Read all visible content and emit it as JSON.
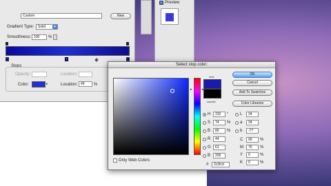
{
  "gradient_editor": {
    "name_value": "Custom",
    "new_button": "New",
    "gradient_type_label": "Gradient Type:",
    "gradient_type_value": "Solid",
    "smoothness_label": "Smoothness:",
    "smoothness_value": "100",
    "smoothness_unit": "%",
    "stops_label": "Stops",
    "opacity_label": "Opacity:",
    "location_label": "Location:",
    "color_label": "Color:",
    "color_location_value": "49",
    "percent": "%",
    "stop_color": "#1f2fd1"
  },
  "styles_panel": {
    "preview_label": "Preview",
    "swatch_color": "#3a3ad8"
  },
  "color_picker": {
    "title": "Select stop color:",
    "new_label": "new",
    "current_label": "current",
    "ok": "OK",
    "cancel": "Cancel",
    "add_swatches": "Add To Swatches",
    "color_libraries": "Color Libraries",
    "only_web_colors": "Only Web Colors",
    "new_color": "#1a1ab0",
    "current_color": "#000000",
    "hsb": [
      {
        "key": "H",
        "value": "232",
        "unit": "°",
        "selected": true
      },
      {
        "key": "S",
        "value": "74",
        "unit": "%",
        "selected": false
      },
      {
        "key": "B",
        "value": "80",
        "unit": "%",
        "selected": false
      }
    ],
    "rgb": [
      {
        "key": "R",
        "value": "44",
        "selected": false
      },
      {
        "key": "G",
        "value": "61",
        "selected": false
      },
      {
        "key": "B",
        "value": "205",
        "selected": false
      }
    ],
    "lab": [
      {
        "key": "L",
        "value": "34",
        "selected": false
      },
      {
        "key": "a",
        "value": "34",
        "selected": false
      },
      {
        "key": "b",
        "value": "-77",
        "selected": false
      }
    ],
    "cmyk": [
      {
        "key": "C",
        "value": "90",
        "unit": "%"
      },
      {
        "key": "M",
        "value": "76",
        "unit": "%"
      },
      {
        "key": "Y",
        "value": "0",
        "unit": "%"
      },
      {
        "key": "K",
        "value": "0",
        "unit": "%"
      }
    ],
    "hex_label": "#",
    "hex_value": "2c3fcd"
  }
}
